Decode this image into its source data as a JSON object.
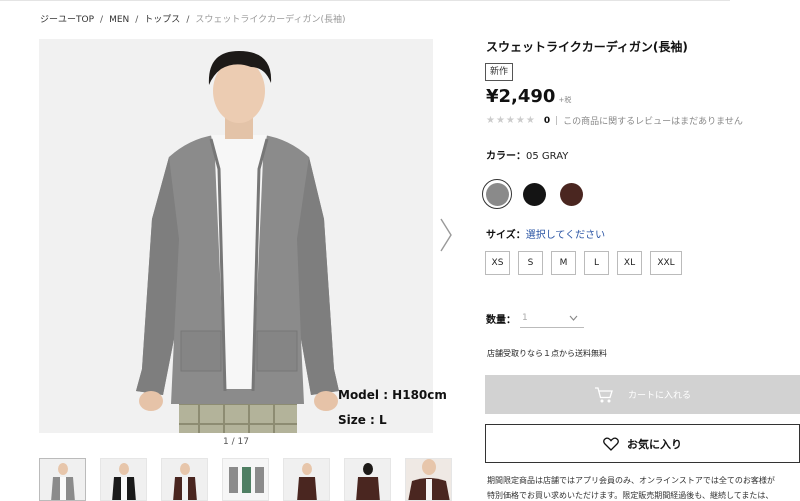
{
  "breadcrumb": [
    "ジーユーTOP",
    "MEN",
    "トップス",
    "スウェットライクカーディガン(長袖)"
  ],
  "gallery": {
    "model_height": "Model : H180cm",
    "model_size": "Size : L",
    "counter": "1 / 17"
  },
  "product": {
    "title": "スウェットライクカーディガン(長袖)",
    "badge": "新作",
    "price": "¥2,490",
    "tax_label": "+税",
    "stars": "★★★★★",
    "review_count": "0",
    "review_sep": "|",
    "review_text": "この商品に関するレビューはまだありません"
  },
  "color": {
    "label": "カラー：",
    "value": "05 GRAY",
    "swatches": [
      {
        "name": "gray",
        "hex": "#8a8a8a",
        "selected": true
      },
      {
        "name": "black",
        "hex": "#141414",
        "selected": false
      },
      {
        "name": "brown",
        "hex": "#4a2620",
        "selected": false
      }
    ]
  },
  "size": {
    "label": "サイズ：",
    "hint": "選択してください",
    "options": [
      "XS",
      "S",
      "M",
      "L",
      "XL",
      "XXL"
    ]
  },
  "quantity": {
    "label": "数量：",
    "value": "1"
  },
  "store_note": "店舗受取りなら１点から送料無料",
  "buttons": {
    "cart": "カートに入れる",
    "favorite": "お気に入り"
  },
  "notice": [
    "期間限定商品は店舗ではアプリ会員のみ、オンラインストアでは全てのお客様が",
    "特別価格でお買い求めいただけます。限定販売期間経過後も、継続してまたは、"
  ],
  "colors": {
    "cart_disabled": "#d2d2d2",
    "link_blue": "#2a54a4",
    "image_bg": "#f1f1f1"
  }
}
